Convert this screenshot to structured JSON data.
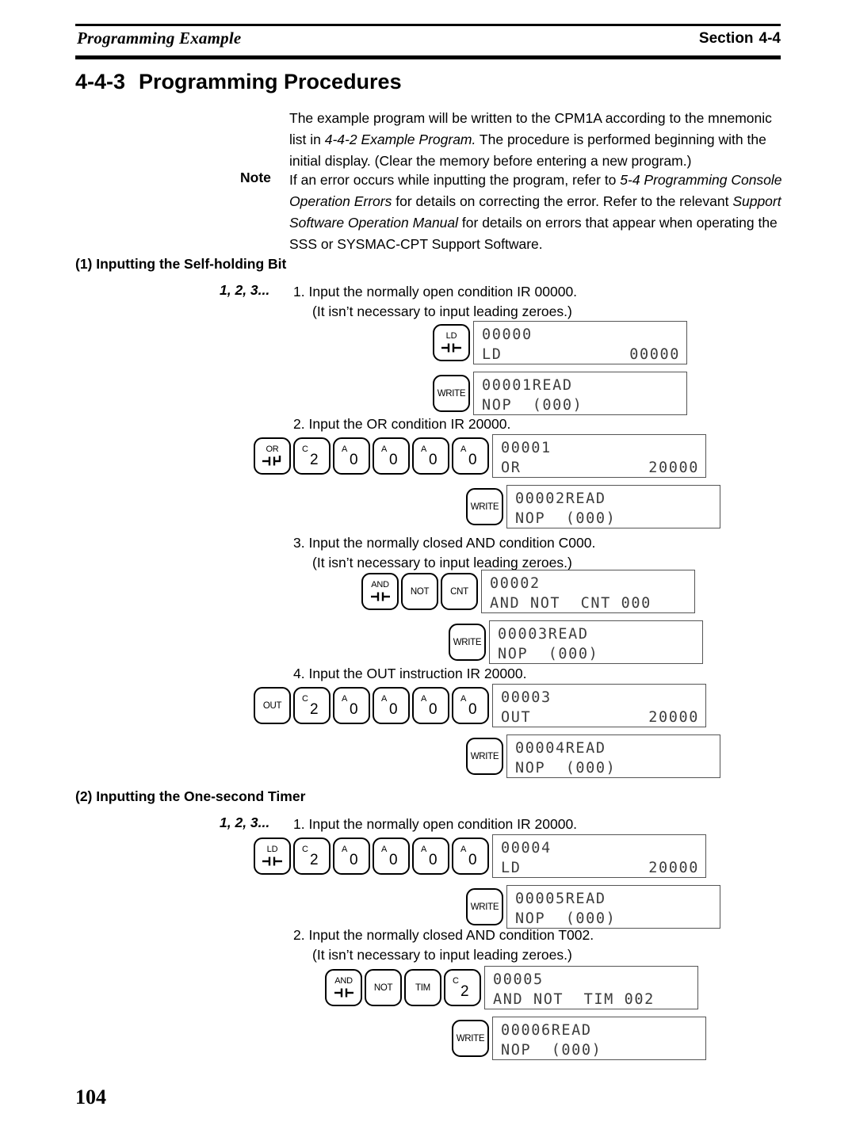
{
  "header": {
    "left_title": "Programming Example",
    "right_label": "Section",
    "right_number": "4-4"
  },
  "title": {
    "number": "4-4-3",
    "text": "Programming Procedures"
  },
  "intro": {
    "part1": "The example program will be written to the CPM1A according to the mnemonic list in ",
    "italic1": "4-4-2 Example Program.",
    "part2": " The procedure is performed beginning with the initial display. (Clear the memory before entering a new program.)"
  },
  "note": {
    "label": "Note",
    "part1": "If an error occurs while inputting the program, refer to ",
    "italic1": "5-4 Programming Console Operation Errors",
    "part2": " for details on correcting the error. Refer to the relevant ",
    "italic2": "Support Software Operation Manual",
    "part3": " for details on errors that appear when operating the SSS or SYSMAC-CPT Support Software."
  },
  "marker": "1, 2, 3...",
  "section1": {
    "heading": "(1) Inputting the Self-holding Bit",
    "steps": [
      {
        "number": "1.",
        "line1": "Input the normally open condition IR 00000.",
        "line2": "(It isn’t necessary to input leading zeroes.)",
        "keys": [
          {
            "name": "ld-key",
            "top": "LD",
            "symbol": "contact-open"
          }
        ],
        "display": {
          "line1": "00000",
          "line2_left": "LD",
          "line2_right": "00000"
        },
        "write_key": "WRITE",
        "write_display": {
          "line1": "00001READ",
          "line2_left": "NOP  (000)",
          "line2_right": ""
        }
      },
      {
        "number": "2.",
        "line1": "Input the OR condition IR 20000.",
        "line2": "",
        "keys": [
          {
            "name": "or-key",
            "top": "OR",
            "symbol": "contact-or"
          },
          {
            "name": "key-2",
            "sup": "C",
            "digit": "2"
          },
          {
            "name": "key-0-a",
            "sup": "A",
            "digit": "0"
          },
          {
            "name": "key-0-b",
            "sup": "A",
            "digit": "0"
          },
          {
            "name": "key-0-c",
            "sup": "A",
            "digit": "0"
          },
          {
            "name": "key-0-d",
            "sup": "A",
            "digit": "0"
          }
        ],
        "display": {
          "line1": "00001",
          "line2_left": "OR",
          "line2_right": "20000"
        },
        "write_key": "WRITE",
        "write_display": {
          "line1": "00002READ",
          "line2_left": "NOP  (000)",
          "line2_right": ""
        }
      },
      {
        "number": "3.",
        "line1": "Input the normally closed AND condition C000.",
        "line2": "(It isn’t necessary to input leading zeroes.)",
        "keys": [
          {
            "name": "and-key",
            "top": "AND",
            "symbol": "contact-and"
          },
          {
            "name": "not-key",
            "mid": "NOT"
          },
          {
            "name": "cnt-key",
            "mid": "CNT"
          }
        ],
        "display": {
          "line1": "00002",
          "line2_left": "AND NOT  CNT 000",
          "line2_right": ""
        },
        "write_key": "WRITE",
        "write_display": {
          "line1": "00003READ",
          "line2_left": "NOP  (000)",
          "line2_right": ""
        }
      },
      {
        "number": "4.",
        "line1": "Input the OUT instruction IR 20000.",
        "line2": "",
        "keys": [
          {
            "name": "out-key",
            "mid": "OUT"
          },
          {
            "name": "key-2",
            "sup": "C",
            "digit": "2"
          },
          {
            "name": "key-0-a",
            "sup": "A",
            "digit": "0"
          },
          {
            "name": "key-0-b",
            "sup": "A",
            "digit": "0"
          },
          {
            "name": "key-0-c",
            "sup": "A",
            "digit": "0"
          },
          {
            "name": "key-0-d",
            "sup": "A",
            "digit": "0"
          }
        ],
        "display": {
          "line1": "00003",
          "line2_left": "OUT",
          "line2_right": "20000"
        },
        "write_key": "WRITE",
        "write_display": {
          "line1": "00004READ",
          "line2_left": "NOP  (000)",
          "line2_right": ""
        }
      }
    ]
  },
  "section2": {
    "heading": "(2) Inputting the One-second Timer",
    "steps": [
      {
        "number": "1.",
        "line1": "Input the normally open condition IR 20000.",
        "line2": "",
        "keys": [
          {
            "name": "ld-key",
            "top": "LD",
            "symbol": "contact-open"
          },
          {
            "name": "key-2",
            "sup": "C",
            "digit": "2"
          },
          {
            "name": "key-0-a",
            "sup": "A",
            "digit": "0"
          },
          {
            "name": "key-0-b",
            "sup": "A",
            "digit": "0"
          },
          {
            "name": "key-0-c",
            "sup": "A",
            "digit": "0"
          },
          {
            "name": "key-0-d",
            "sup": "A",
            "digit": "0"
          }
        ],
        "display": {
          "line1": "00004",
          "line2_left": "LD",
          "line2_right": "20000"
        },
        "write_key": "WRITE",
        "write_display": {
          "line1": "00005READ",
          "line2_left": "NOP  (000)",
          "line2_right": ""
        }
      },
      {
        "number": "2.",
        "line1": "Input the normally closed AND condition T002.",
        "line2": "(It isn’t necessary to input leading zeroes.)",
        "keys": [
          {
            "name": "and-key",
            "top": "AND",
            "symbol": "contact-and"
          },
          {
            "name": "not-key",
            "mid": "NOT"
          },
          {
            "name": "tim-key",
            "mid": "TIM"
          },
          {
            "name": "key-2",
            "sup": "C",
            "digit": "2"
          }
        ],
        "display": {
          "line1": "00005",
          "line2_left": "AND NOT  TIM 002",
          "line2_right": ""
        },
        "write_key": "WRITE",
        "write_display": {
          "line1": "00006READ",
          "line2_left": "NOP  (000)",
          "line2_right": ""
        }
      }
    ]
  },
  "page_number": "104"
}
